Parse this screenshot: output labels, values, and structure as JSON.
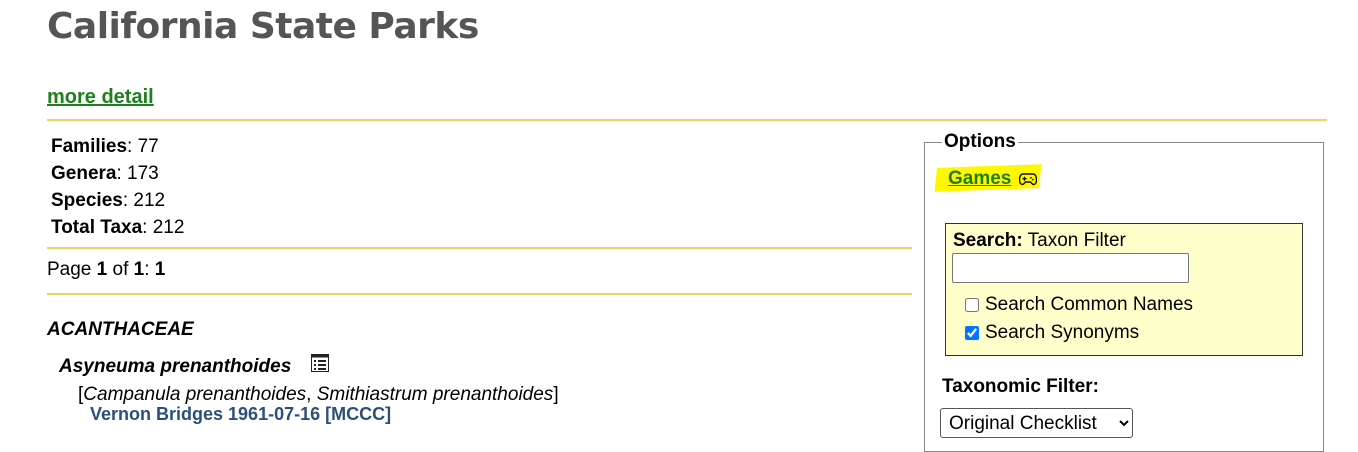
{
  "page": {
    "title": "California State Parks",
    "more_detail_link": "more detail"
  },
  "stats": {
    "families_label": "Families",
    "families_value": ": 77",
    "genera_label": "Genera",
    "genera_value": ": 173",
    "species_label": "Species",
    "species_value": ": 212",
    "total_taxa_label": "Total Taxa",
    "total_taxa_value": ": 212"
  },
  "pager": {
    "prefix": "Page ",
    "current": "1",
    "of_text": " of ",
    "total": "1",
    "sep": ": ",
    "count": "1"
  },
  "listing": {
    "family": "ACANTHACEAE",
    "taxon_name": "Asyneuma prenanthoides",
    "taxon_icon": "list-detail-icon",
    "synonyms_open": "[",
    "synonym_1": "Campanula prenanthoides",
    "synonyms_sep": ", ",
    "synonym_2": "Smithiastrum prenanthoides",
    "synonyms_close": "]",
    "voucher": "Vernon Bridges 1961-07-16 [MCCC]"
  },
  "options": {
    "legend": "Options",
    "games_link": "Games",
    "games_icon": "gamepad-icon",
    "search_label": "Search:",
    "search_sublabel": " Taxon Filter",
    "search_value": "",
    "common_names_label": "Search Common Names",
    "common_names_checked": false,
    "synonyms_label": "Search Synonyms",
    "synonyms_checked": true,
    "taxonomic_filter_label": "Taxonomic Filter:",
    "taxonomic_filter_selected": "Original Checklist"
  },
  "colors": {
    "link_green": "#1e7f1e",
    "rule_yellow": "#f0d060",
    "search_bg": "#ffffcc",
    "highlight": "#fff700",
    "voucher_blue": "#2b4f7a"
  }
}
